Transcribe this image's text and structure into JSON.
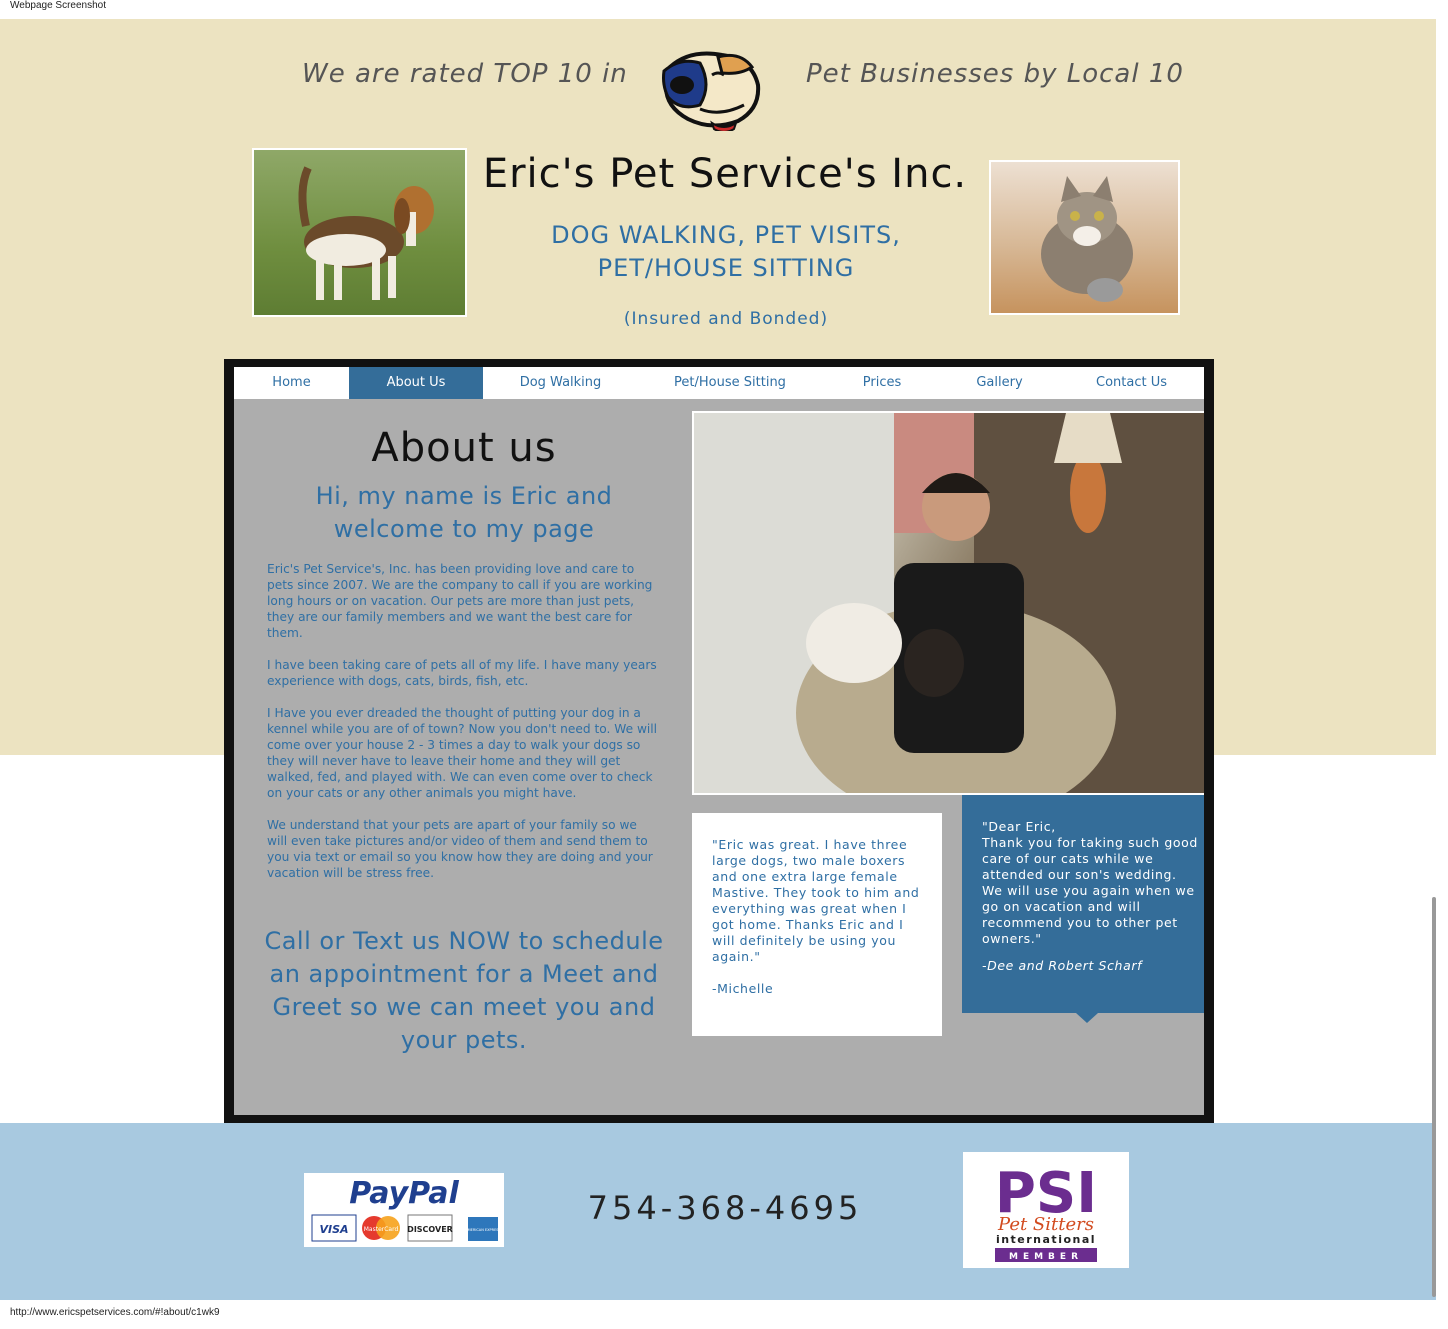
{
  "window": {
    "caption": "Webpage Screenshot",
    "status_url": "http://www.ericspetservices.com/#!about/c1wk9"
  },
  "header": {
    "rated_left": "We are rated TOP 10 in",
    "rated_right": "Pet Businesses by Local 10",
    "site_title": "Eric's Pet Service's Inc.",
    "tagline_line1": "DOG WALKING, PET VISITS,",
    "tagline_line2": "PET/HOUSE SITTING",
    "insured": "(Insured and Bonded)"
  },
  "nav": {
    "items": [
      {
        "label": "Home",
        "active": false
      },
      {
        "label": "About Us",
        "active": true
      },
      {
        "label": "Dog Walking",
        "active": false
      },
      {
        "label": "Pet/House Sitting",
        "active": false
      },
      {
        "label": "Prices",
        "active": false
      },
      {
        "label": "Gallery",
        "active": false
      },
      {
        "label": "Contact Us",
        "active": false
      }
    ]
  },
  "about": {
    "heading": "About us",
    "sub_line1": "Hi, my name is Eric and",
    "sub_line2": "welcome to my page",
    "paragraphs": [
      "Eric's Pet Service's, Inc. has been providing love and care to pets since 2007.  We are the company to call if you are working long hours or on vacation.  Our pets are more than just pets, they are our family members and we want the best care for them.",
      "I have been taking care of pets all of my life.  I have many years experience with dogs, cats, birds, fish, etc.",
      "I Have you ever dreaded the thought of putting your dog in a kennel while you are of of town? Now you don't need to. We will come over your house 2 - 3 times a day to walk your dogs so they will never have to leave their home and they will get walked, fed, and played with. We can even come over to check on your cats or any other animals you might have.",
      "We understand that your pets are apart of your family so we will even take pictures and/or video of them and send them to you via text or email so you know how they are doing and your vacation will be stress free."
    ],
    "cta": "Call or Text us NOW to schedule an appointment for a Meet and Greet so we can meet you and your pets."
  },
  "testimonials": {
    "white": {
      "quote": "\"Eric was great. I have three large dogs, two male boxers and one extra large female Mastive. They took to him and everything was great when I got home. Thanks Eric and I will definitely be using you again.\"",
      "signature": "-Michelle"
    },
    "blue": {
      "greeting": "\"Dear Eric,",
      "quote": "Thank you for taking such good care of our cats while we attended our son's wedding.  We will use you again when we go on vacation and will recommend you to other pet owners.\"",
      "signature": "-Dee and Robert Scharf"
    }
  },
  "footer": {
    "phone": "754-368-4695",
    "paypal_logo_text": "PayPal",
    "cards": [
      "VISA",
      "MasterCard",
      "DISCOVER",
      "AMERICAN EXPRESS"
    ],
    "psi_logo_text": "PSI",
    "psi_sub": "Pet Sitters",
    "psi_intl": "international",
    "psi_member": "MEMBER"
  },
  "colors": {
    "beige": "#ece3c1",
    "accent_blue": "#2f6fa4",
    "nav_active": "#346d99",
    "footer_blue": "#a8c9e0",
    "content_gray": "#adadad"
  }
}
